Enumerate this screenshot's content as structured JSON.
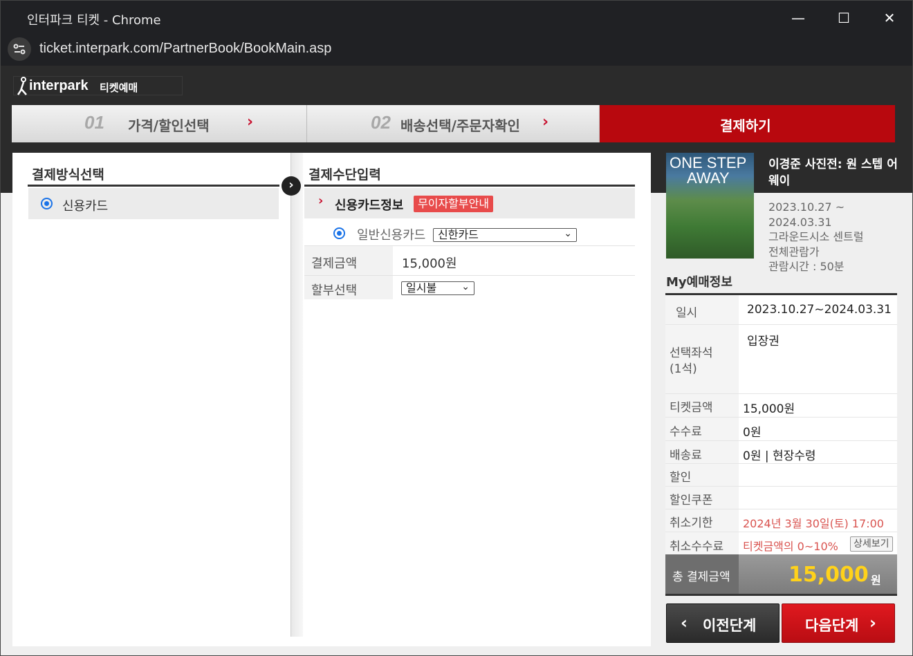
{
  "window": {
    "title": "인터파크 티켓 - Chrome",
    "url": "ticket.interpark.com/PartnerBook/BookMain.asp"
  },
  "logo": {
    "brand": "interpark",
    "sub": "티켓예매"
  },
  "steps": [
    {
      "num": "01",
      "label": "가격/할인선택",
      "arrow": "›"
    },
    {
      "num": "02",
      "label": "배송선택/주문자확인",
      "arrow": "›"
    },
    {
      "label": "결제하기"
    }
  ],
  "payment_method": {
    "title": "결제방식선택",
    "option": "신용카드"
  },
  "payment_input": {
    "title": "결제수단입력",
    "section": "신용카드정보",
    "badge": "무이자할부안내",
    "card_type": "일반신용카드",
    "card_select": "신한카드",
    "amount_label": "결제금액",
    "amount": "15,000원",
    "installment_label": "할부선택",
    "installment": "일시불"
  },
  "show": {
    "poster_line1": "ONE STEP",
    "poster_line2": "AWAY",
    "title": "이경준 사진전: 원 스텝 어웨이",
    "dates": "2023.10.27 ~ 2024.03.31",
    "venue": "그라운드시소 센트럴",
    "rating": "전체관람가",
    "runtime": "관람시간 : 50분"
  },
  "my_booking": {
    "title": "My예매정보",
    "rows": {
      "date_k": "일시",
      "date_v": "2023.10.27~2024.03.31",
      "seat_k": "선택좌석",
      "seat_k2": "(1석)",
      "seat_v": "입장권",
      "price_k": "티켓금액",
      "price_v": "15,000원",
      "fee_k": "수수료",
      "fee_v": "0원",
      "ship_k": "배송료",
      "ship_v": "0원 | 현장수령",
      "disc_k": "할인",
      "disc_v": "",
      "coupon_k": "할인쿠폰",
      "coupon_v": "",
      "cancel_k": "취소기한",
      "cancel_v": "2024년 3월 30일(토) 17:00",
      "cfee_k": "취소수수료",
      "cfee_v": "티켓금액의 0~10%",
      "cfee_btn": "상세보기"
    },
    "total_label": "총 결제금액",
    "total_value": "15,000",
    "total_unit": "원"
  },
  "buttons": {
    "prev": "이전단계",
    "next": "다음단계"
  }
}
